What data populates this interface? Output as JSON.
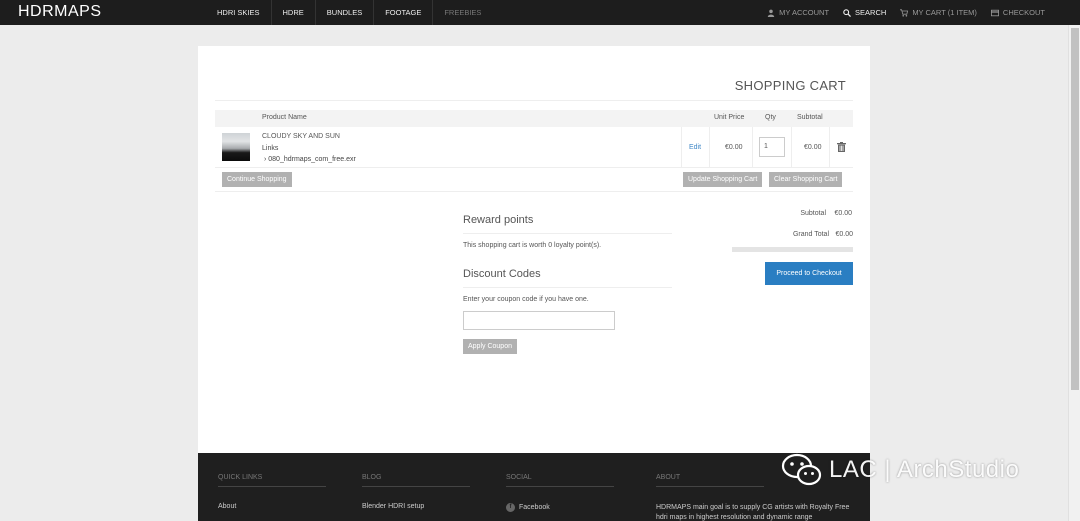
{
  "header": {
    "logo": "HDRMAPS",
    "nav": [
      "HDRI SKIES",
      "HDRE",
      "BUNDLES",
      "FOOTAGE",
      "FREEBIES"
    ],
    "account": "MY ACCOUNT",
    "search": "SEARCH",
    "cart": "MY CART (1 ITEM)",
    "checkout": "CHECKOUT"
  },
  "page": {
    "title": "SHOPPING CART"
  },
  "table": {
    "headers": {
      "product": "Product Name",
      "unit_price": "Unit Price",
      "qty": "Qty",
      "subtotal": "Subtotal"
    },
    "rows": [
      {
        "name": "CLOUDY SKY AND SUN",
        "links_label": "Links",
        "file": "› 080_hdrmaps_com_free.exr",
        "edit": "Edit",
        "unit_price": "€0.00",
        "qty": "1",
        "subtotal": "€0.00"
      }
    ],
    "buttons": {
      "continue": "Continue Shopping",
      "update": "Update Shopping Cart",
      "clear": "Clear Shopping Cart"
    }
  },
  "reward": {
    "title": "Reward points",
    "text": "This shopping cart is worth 0 loyalty point(s)."
  },
  "discount": {
    "title": "Discount Codes",
    "text": "Enter your coupon code if you have one.",
    "button": "Apply Coupon"
  },
  "totals": {
    "subtotal_label": "Subtotal",
    "subtotal_value": "€0.00",
    "grand_label": "Grand Total",
    "grand_value": "€0.00",
    "checkout_button": "Proceed to Checkout"
  },
  "footer": {
    "quick_links": {
      "title": "QUICK LINKS",
      "items": [
        "About"
      ]
    },
    "blog": {
      "title": "BLOG",
      "items": [
        "Blender HDRI setup"
      ]
    },
    "social": {
      "title": "SOCIAL",
      "items": [
        "Facebook"
      ]
    },
    "about": {
      "title": "ABOUT",
      "text": "HDRMAPS main goal is to supply CG artists with Royalty Free hdri maps in highest resolution and dynamic range"
    }
  },
  "watermark": "LAC | ArchStudio",
  "colors": {
    "accent": "#2a7ec2",
    "topbar": "#1d1d1d",
    "button_gray": "#b1b1b1"
  }
}
